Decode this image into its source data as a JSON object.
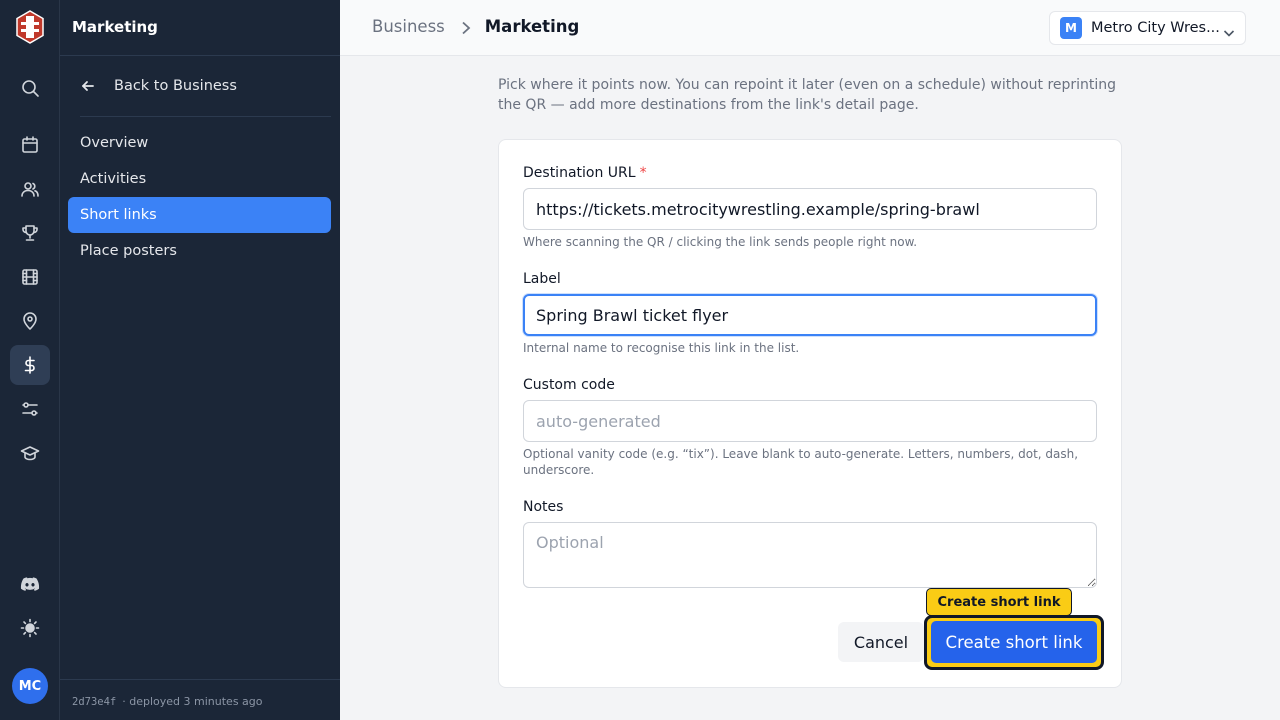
{
  "sidebar": {
    "title": "Marketing",
    "back_label": "Back to Business",
    "items": [
      {
        "label": "Overview",
        "active": false
      },
      {
        "label": "Activities",
        "active": false
      },
      {
        "label": "Short links",
        "active": true
      },
      {
        "label": "Place posters",
        "active": false
      }
    ],
    "deploy_hash": "2d73e4f",
    "deploy_text": "· deployed 3 minutes ago"
  },
  "rail": {
    "icons": [
      "search-icon",
      "calendar-icon",
      "users-icon",
      "trophy-icon",
      "film-icon",
      "map-pin-icon",
      "dollar-icon",
      "sliders-icon",
      "graduation-cap-icon",
      "discord-icon",
      "sun-icon"
    ],
    "active_icon": "dollar-icon",
    "avatar_initials": "MC"
  },
  "header": {
    "breadcrumb_parent": "Business",
    "breadcrumb_current": "Marketing",
    "org_initial": "M",
    "org_name": "Metro City Wres..."
  },
  "form": {
    "intro": "Pick where it points now. You can repoint it later (even on a schedule) without reprinting the QR — add more destinations from the link's detail page.",
    "destination": {
      "label": "Destination URL",
      "required_mark": "*",
      "value": "https://tickets.metrocitywrestling.example/spring-brawl",
      "help": "Where scanning the QR / clicking the link sends people right now."
    },
    "label_field": {
      "label": "Label",
      "value": "Spring Brawl ticket flyer",
      "help": "Internal name to recognise this link in the list."
    },
    "custom_code": {
      "label": "Custom code",
      "placeholder": "auto-generated",
      "help": "Optional vanity code (e.g. “tix”). Leave blank to auto-generate. Letters, numbers, dot, dash, underscore."
    },
    "notes": {
      "label": "Notes",
      "placeholder": "Optional"
    },
    "cancel_label": "Cancel",
    "submit_label": "Create short link",
    "tooltip": "Create short link"
  },
  "colors": {
    "primary": "#2563eb",
    "highlight": "#facc15",
    "sidebar_bg": "#1b2637"
  }
}
